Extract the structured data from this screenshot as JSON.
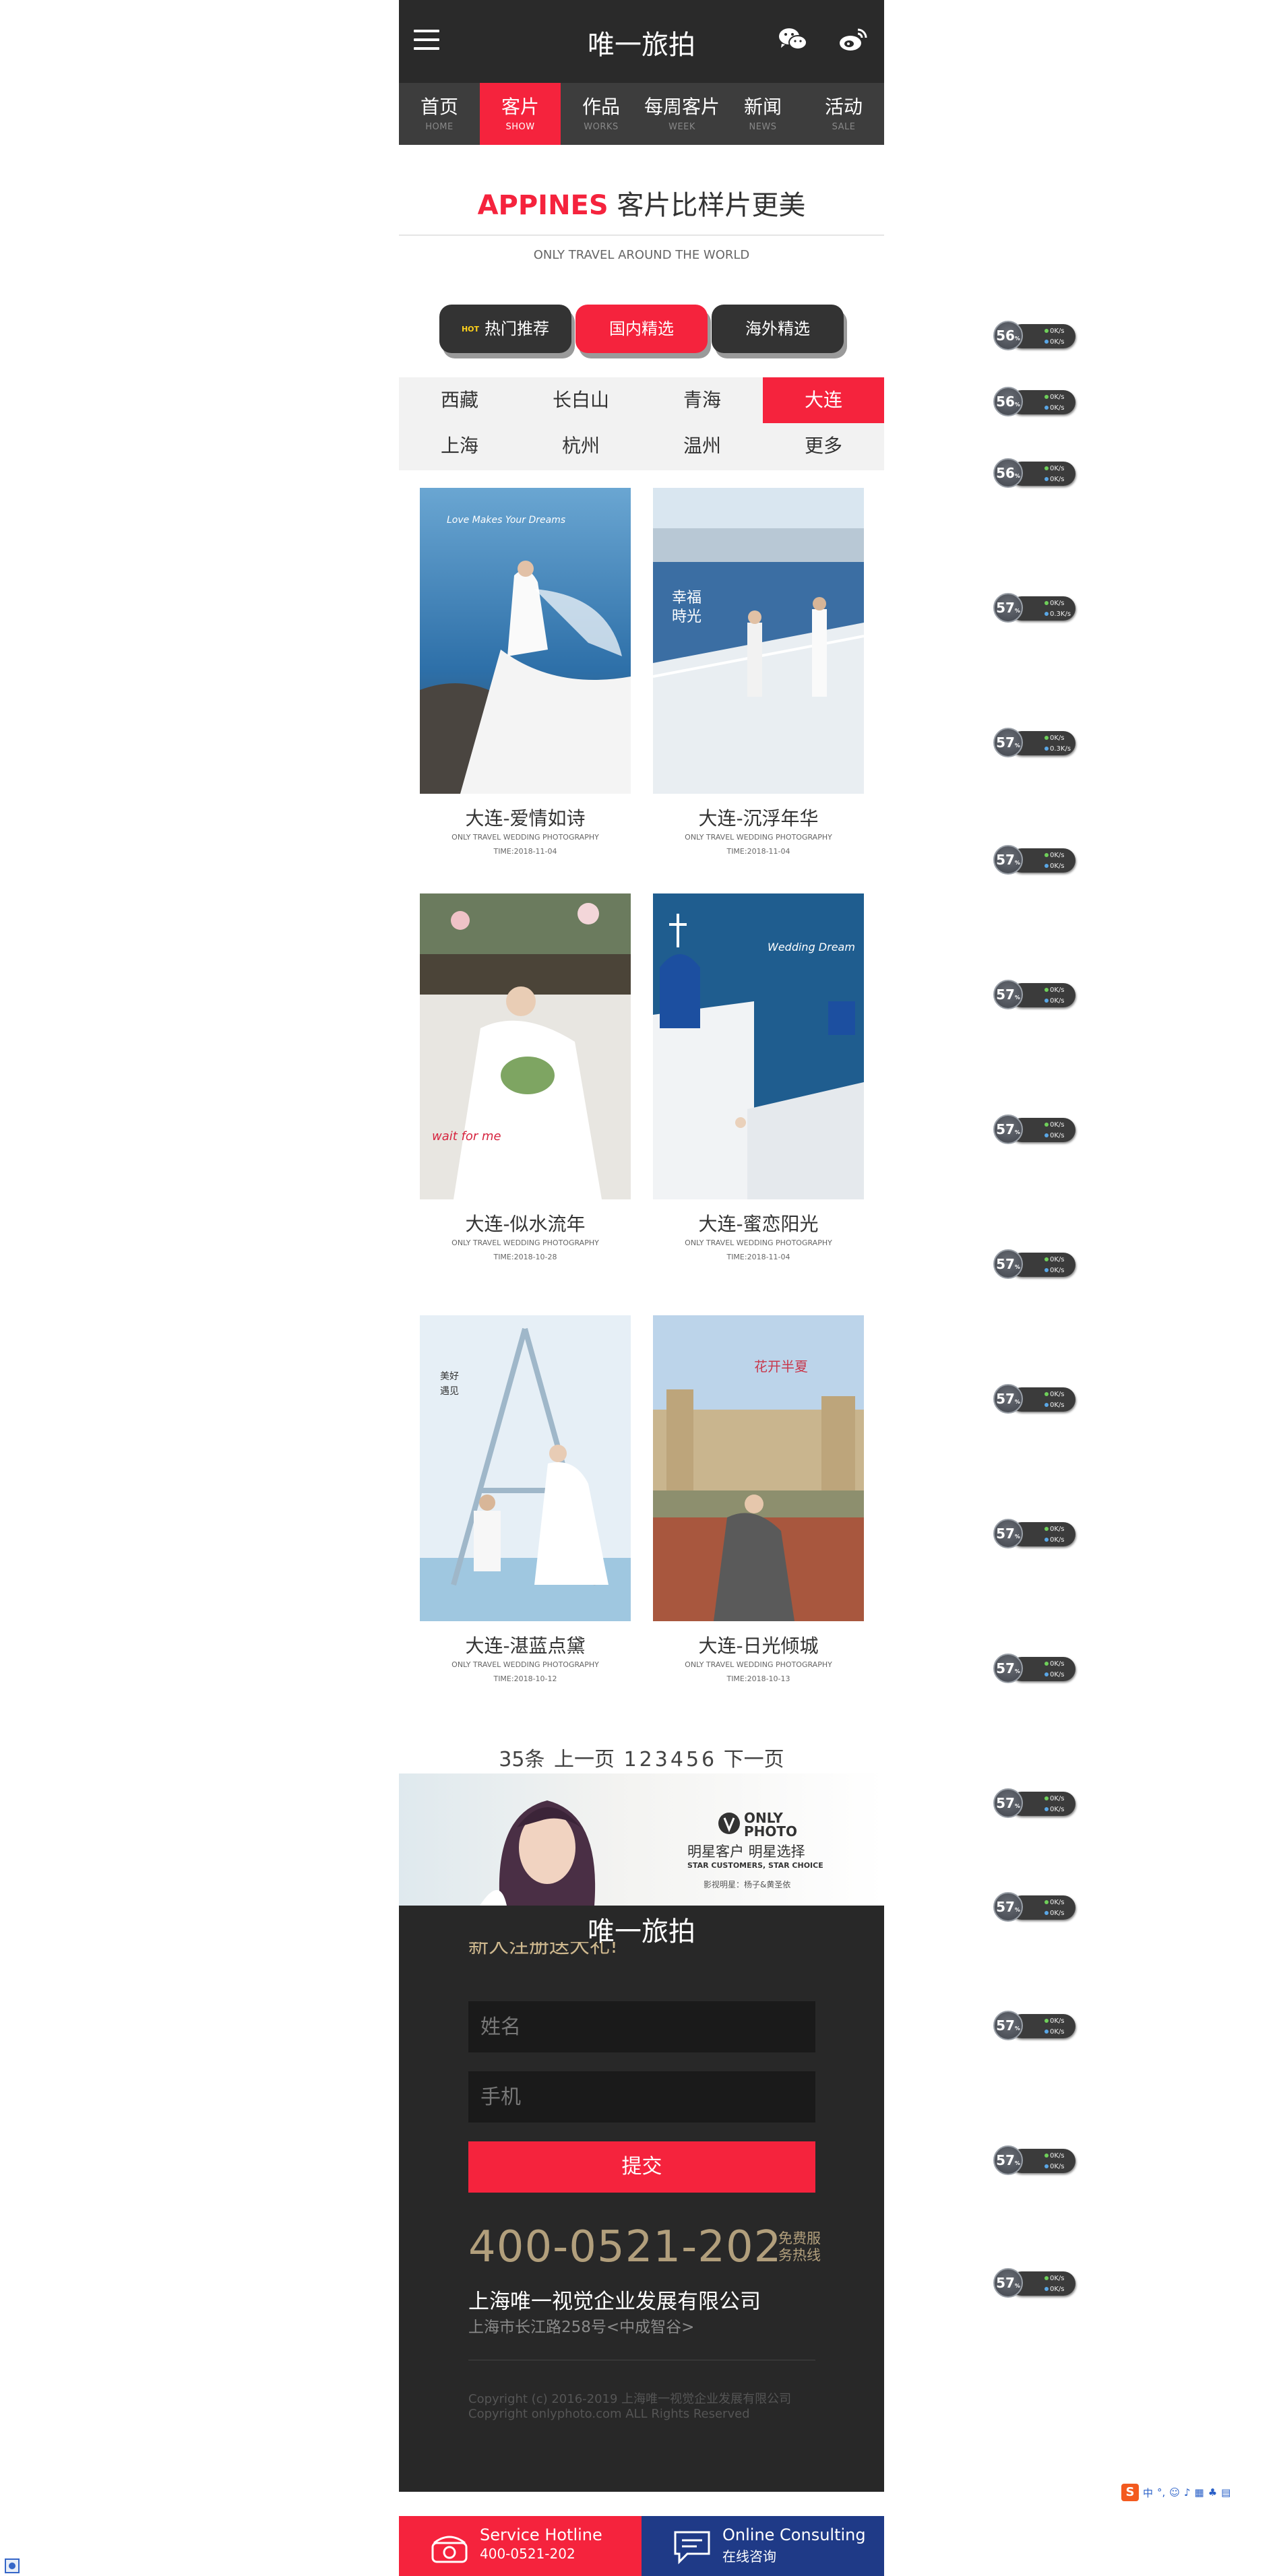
{
  "header": {
    "title": "唯一旅拍"
  },
  "nav": [
    {
      "zh": "首页",
      "en": "HOME",
      "active": false
    },
    {
      "zh": "客片",
      "en": "SHOW",
      "active": true
    },
    {
      "zh": "作品",
      "en": "WORKS",
      "active": false
    },
    {
      "zh": "每周客片",
      "en": "WEEK",
      "active": false
    },
    {
      "zh": "新闻",
      "en": "NEWS",
      "active": false
    },
    {
      "zh": "活动",
      "en": "SALE",
      "active": false
    }
  ],
  "section": {
    "brand": "APPINES",
    "title_rest": " 客片比样片更美",
    "subtitle": "ONLY TRAVEL AROUND THE WORLD"
  },
  "tabs": {
    "hot_badge": "HOT",
    "hot": "热门推荐",
    "domestic": "国内精选",
    "overseas": "海外精选"
  },
  "cities": [
    "西藏",
    "长白山",
    "青海",
    "大连",
    "上海",
    "杭州",
    "温州",
    "更多"
  ],
  "active_city": "大连",
  "cards": [
    {
      "title": "大连-爱情如诗",
      "sub": "ONLY TRAVEL WEDDING PHOTOGRAPHY",
      "date": "TIME:2018-11-04",
      "overlay": "Love Makes Your Dreams"
    },
    {
      "title": "大连-沉浮年华",
      "sub": "ONLY TRAVEL WEDDING PHOTOGRAPHY",
      "date": "TIME:2018-11-04",
      "overlay": "幸福時光"
    },
    {
      "title": "大连-似水流年",
      "sub": "ONLY TRAVEL WEDDING PHOTOGRAPHY",
      "date": "TIME:2018-10-28",
      "overlay": "wait for me"
    },
    {
      "title": "大连-蜜恋阳光",
      "sub": "ONLY TRAVEL WEDDING PHOTOGRAPHY",
      "date": "TIME:2018-11-04",
      "overlay": "Wedding Dream"
    },
    {
      "title": "大连-湛蓝点黛",
      "sub": "ONLY TRAVEL WEDDING PHOTOGRAPHY",
      "date": "TIME:2018-10-12",
      "overlay": "美好遇见"
    },
    {
      "title": "大连-日光倾城",
      "sub": "ONLY TRAVEL WEDDING PHOTOGRAPHY",
      "date": "TIME:2018-10-13",
      "overlay": "花开半夏"
    }
  ],
  "pager": {
    "total": "35条",
    "prev": "上一页",
    "pages": [
      "1",
      "2",
      "3",
      "4",
      "5",
      "6"
    ],
    "next": "下一页"
  },
  "banner": {
    "logo": "ONLY PHOTO",
    "headline": "明星客户  明星选择",
    "tagline": "STAR CUSTOMERS, STAR CHOICE",
    "note": "影视明星：杨子&黄圣依"
  },
  "footer": {
    "title": "唯一旅拍",
    "promo": "新人注册送大礼!",
    "name_placeholder": "姓名",
    "phone_placeholder": "手机",
    "submit": "提交",
    "phone": "400-0521-202",
    "phone_note": "免费服务热线",
    "company": "上海唯一视觉企业发展有限公司",
    "address": "上海市长江路258号<中成智谷>",
    "copy1": "Copyright (c) 2016-2019 上海唯一视觉企业发展有限公司",
    "copy2": "Copyright onlyphoto.com ALL Rights Reserved"
  },
  "bottom_bar": {
    "hotline_label": "Service Hotline",
    "hotline_number": "400-0521-202",
    "consult_label": "Online Consulting",
    "consult_sub": "在线咨询"
  },
  "speed_widgets": [
    "56",
    "56",
    "56",
    "57",
    "57",
    "57",
    "57",
    "57",
    "57",
    "57",
    "57",
    "57",
    "57",
    "57",
    "57",
    "57",
    "57"
  ],
  "speed_unit": "%",
  "speed_stats": [
    "0K/s",
    "0.3K/s",
    "0K/s"
  ],
  "ime": {
    "logo": "S",
    "label": "中"
  },
  "colors": {
    "accent": "#f5233d",
    "dark": "#2a2a2a",
    "navy": "#1f3a87",
    "gold": "#b29f7c"
  }
}
